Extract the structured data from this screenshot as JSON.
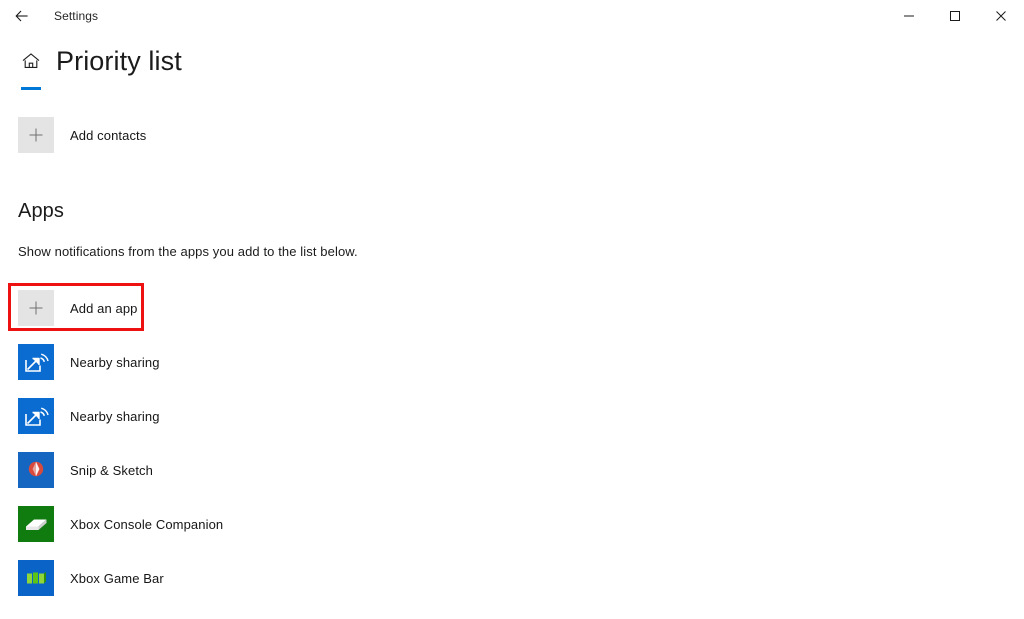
{
  "titlebar": {
    "back_icon": "back-arrow-icon",
    "app_title": "Settings",
    "minimize_icon": "minimize-icon",
    "maximize_icon": "maximize-icon",
    "close_icon": "close-icon"
  },
  "header": {
    "home_icon": "home-icon",
    "title": "Priority list",
    "accent_color": "#0078d7"
  },
  "contacts": {
    "add_label": "Add contacts",
    "add_icon": "plus-icon"
  },
  "apps_section": {
    "heading": "Apps",
    "description": "Show notifications from the apps you add to the list below.",
    "add_app": {
      "label": "Add an app",
      "icon": "plus-icon",
      "highlighted": true,
      "highlight_color": "#ee1111"
    },
    "items": [
      {
        "label": "Nearby sharing",
        "icon": "nearby-sharing-icon",
        "color": "#0a6cd0"
      },
      {
        "label": "Nearby sharing",
        "icon": "nearby-sharing-icon",
        "color": "#0a6cd0"
      },
      {
        "label": "Snip & Sketch",
        "icon": "snip-and-sketch-icon",
        "color": "#1466c0"
      },
      {
        "label": "Xbox Console Companion",
        "icon": "xbox-console-companion-icon",
        "color": "#107c10"
      },
      {
        "label": "Xbox Game Bar",
        "icon": "xbox-game-bar-icon",
        "color": "#0a64c8"
      }
    ]
  }
}
